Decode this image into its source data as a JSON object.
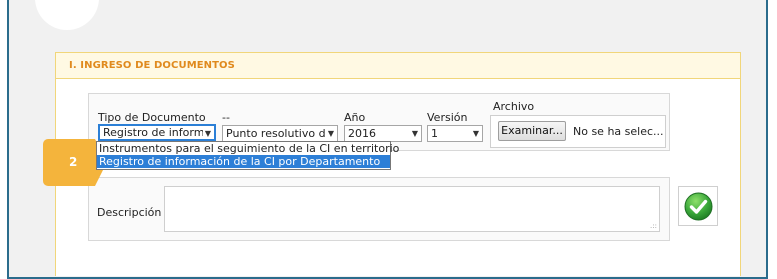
{
  "section": {
    "title": "I. INGRESO DE DOCUMENTOS"
  },
  "form": {
    "tipo_documento": {
      "label": "Tipo de Documento",
      "value": "Registro de informa",
      "options": [
        "Instrumentos para el seguimiento de la CI en territorio",
        "Registro de información de la CI por Departamento"
      ],
      "highlighted_option": 1
    },
    "second_select": {
      "label": "--",
      "value": "Punto resolutivo de"
    },
    "anio": {
      "label": "Año",
      "value": "2016"
    },
    "version": {
      "label": "Versión",
      "value": "1"
    },
    "archivo": {
      "label": "Archivo",
      "button_label": "Examinar...",
      "status": "No se ha selec..."
    },
    "descripcion": {
      "label": "Descripción",
      "value": ""
    }
  },
  "step_badge": {
    "number": "2"
  },
  "colors": {
    "frame_border": "#2b6c8c",
    "header_text": "#e08a1e",
    "header_bg": "#fff9e3",
    "badge": "#f4b43c",
    "selection": "#2d7fd7",
    "confirm_green": "#3aa73a"
  },
  "icons": {
    "confirm": "check-circle-icon",
    "select_arrow": "chevron-down-icon"
  }
}
